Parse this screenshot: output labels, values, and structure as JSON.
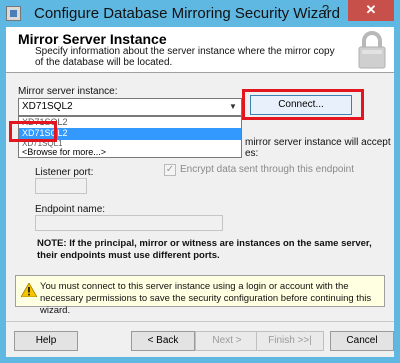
{
  "window": {
    "title": "Configure Database Mirroring Security Wizard",
    "help_glyph": "?",
    "close_glyph": "✕"
  },
  "header": {
    "title": "Mirror Server Instance",
    "description": "Specify information about the server instance where the mirror copy of the database will be located."
  },
  "form": {
    "instance_label": "Mirror server instance:",
    "instance_value": "XD71SQL2",
    "connect_label": "Connect...",
    "dropdown_items": [
      "XD71SQL2",
      "XD71SQL2",
      "XD71SQL1",
      "<Browse for more...>"
    ],
    "right_text_line1": "mirror server instance will accept",
    "right_text_line2": "es:",
    "listener_port_label": "Listener port:",
    "listener_port_value": "",
    "encrypt_label": "Encrypt data sent through this endpoint",
    "endpoint_name_label": "Endpoint name:",
    "endpoint_name_value": "",
    "note": "NOTE: If the principal, mirror or witness are instances on the same server, their endpoints must use different ports."
  },
  "warning": {
    "text": "You must connect to this server instance using a login or account with the necessary permissions to save the security configuration before continuing this wizard.",
    "icon": "warning-icon"
  },
  "buttons": {
    "help": "Help",
    "back": "< Back",
    "next": "Next >",
    "finish": "Finish >>|",
    "cancel": "Cancel"
  },
  "colors": {
    "titlebar": "#5fb8e2",
    "close": "#c7504b",
    "highlight": "#3399ff",
    "annotation_red": "#e3151e",
    "warning_bg": "#ffffe1"
  }
}
